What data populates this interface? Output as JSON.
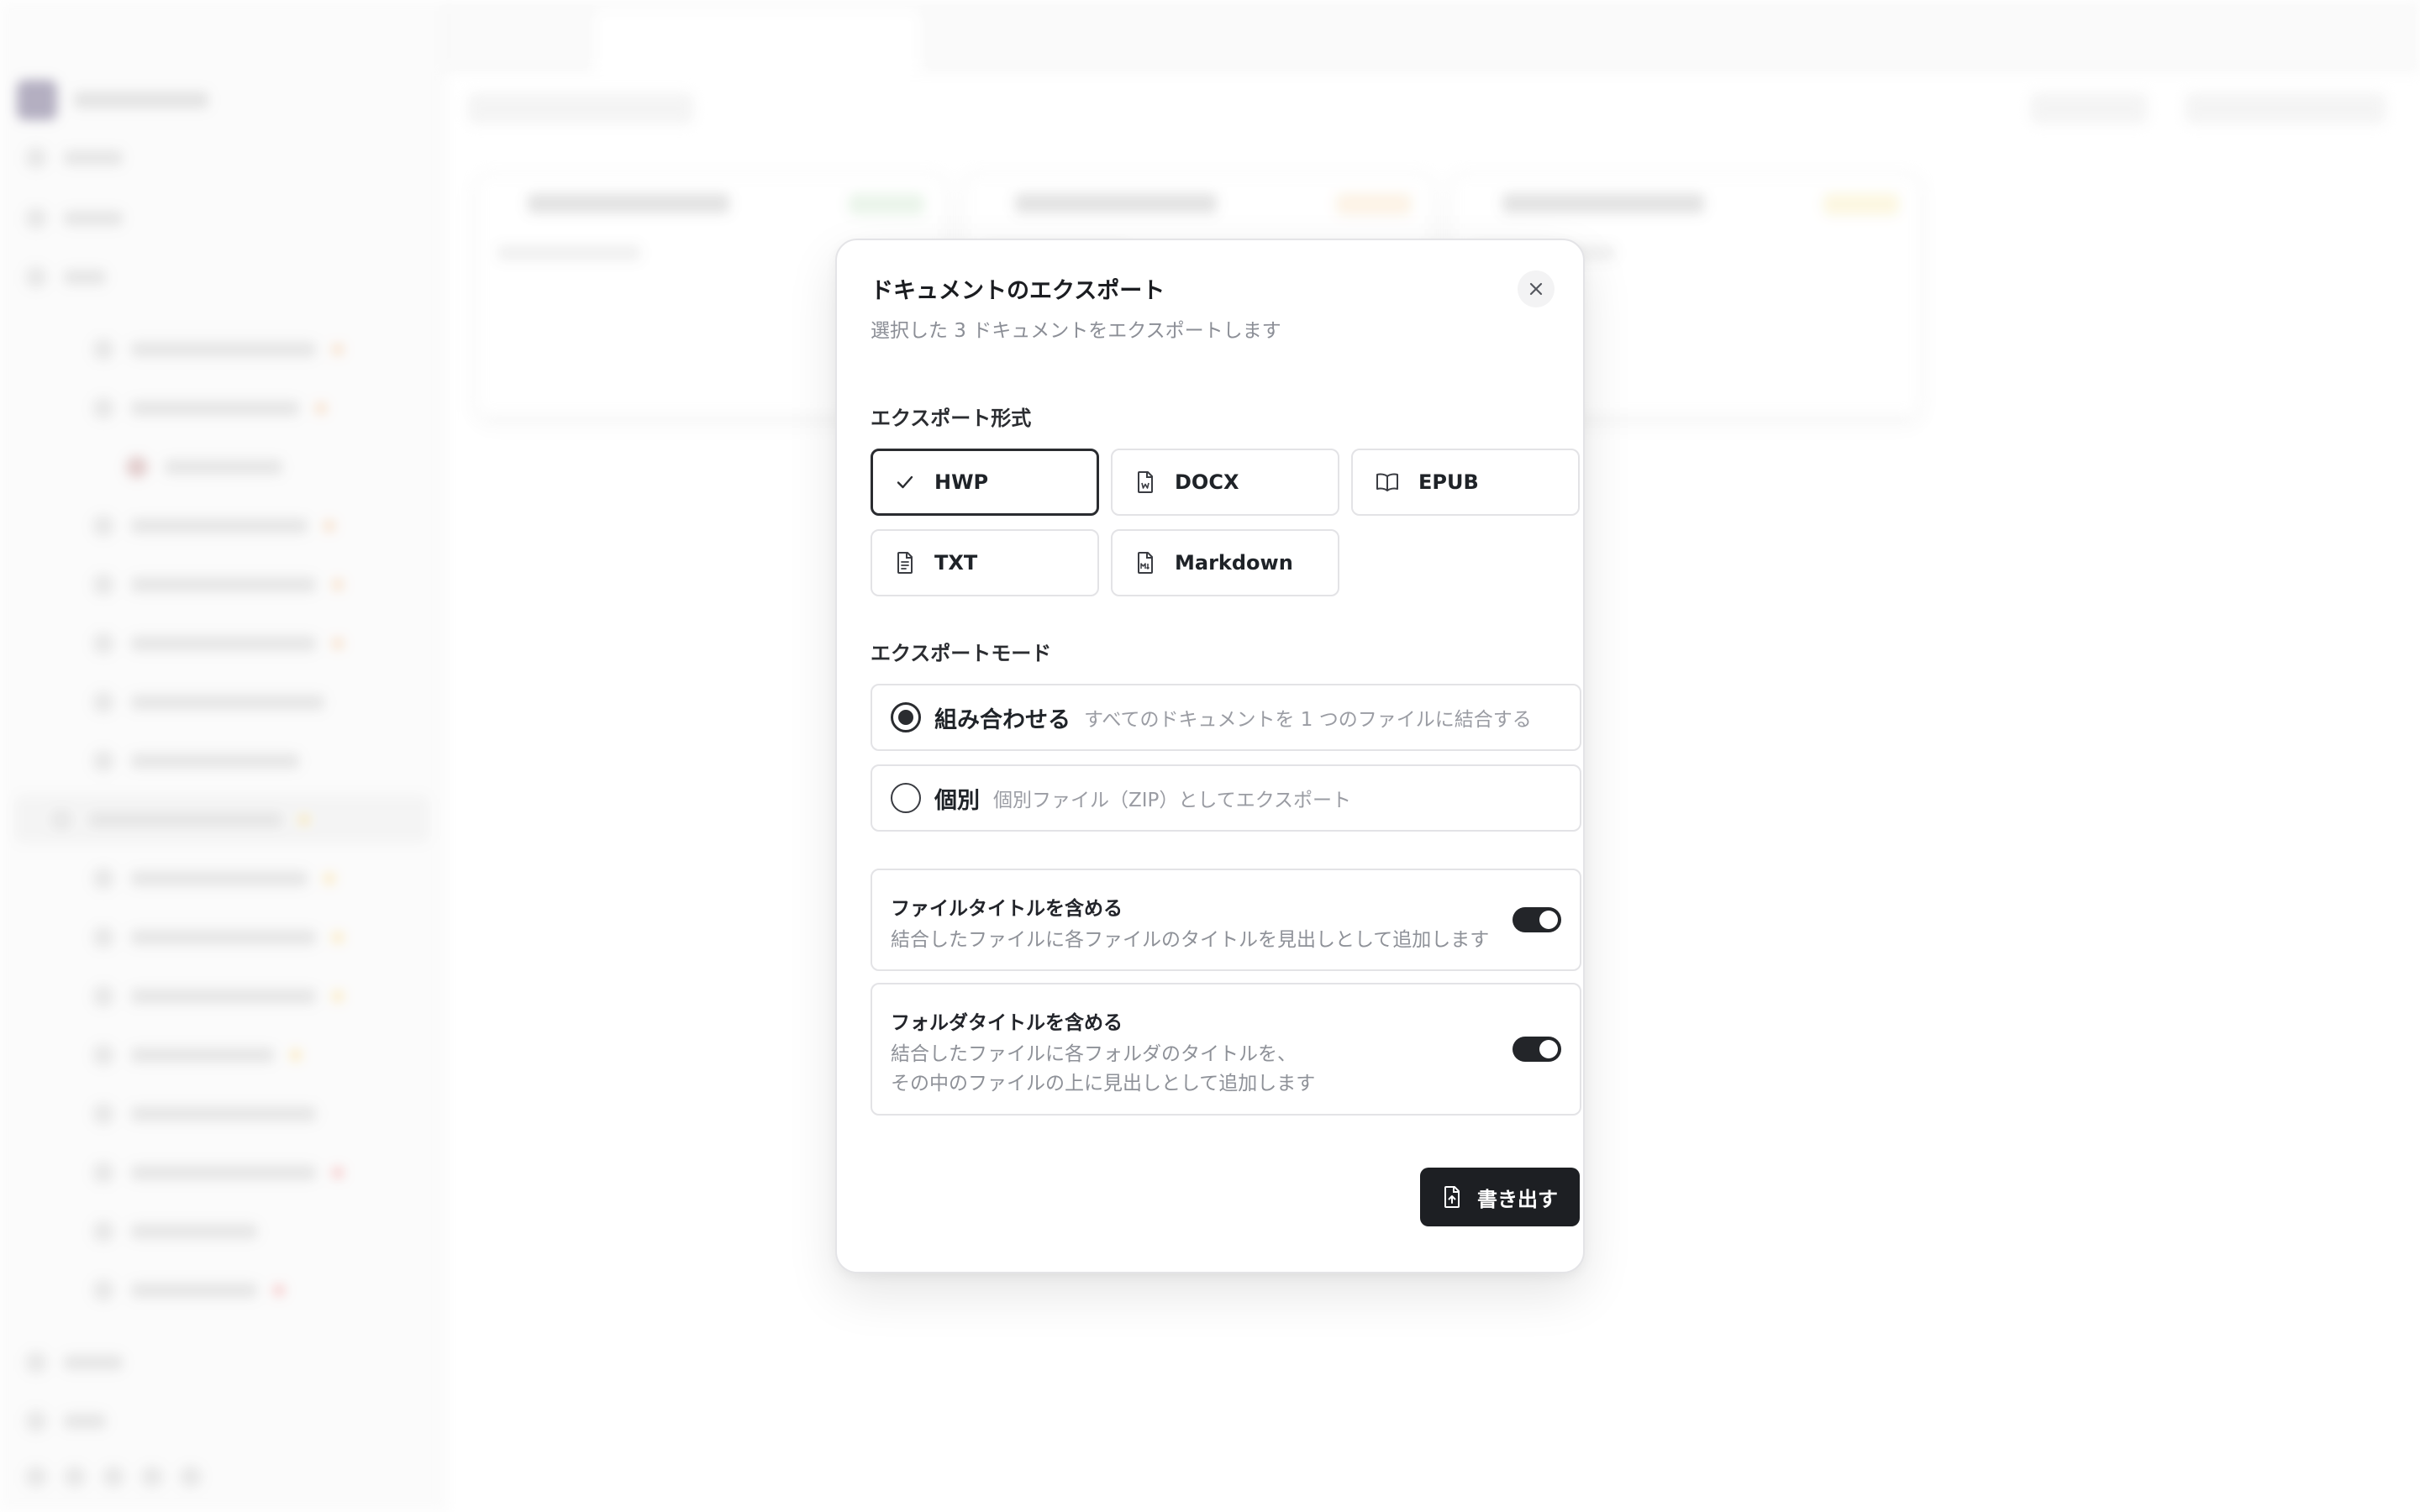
{
  "modal": {
    "title": "ドキュメントのエクスポート",
    "subtitle": "選択した 3 ドキュメントをエクスポートします",
    "close_icon": "close-icon"
  },
  "format": {
    "label": "エクスポート形式",
    "options": [
      {
        "label": "HWP",
        "icon": "check-icon",
        "selected": true
      },
      {
        "label": "DOCX",
        "icon": "docx-file-icon",
        "selected": false
      },
      {
        "label": "EPUB",
        "icon": "book-open-icon",
        "selected": false
      },
      {
        "label": "TXT",
        "icon": "text-file-icon",
        "selected": false
      },
      {
        "label": "Markdown",
        "icon": "markdown-file-icon",
        "selected": false
      }
    ]
  },
  "mode": {
    "label": "エクスポートモード",
    "options": [
      {
        "name": "組み合わせる",
        "desc": "すべてのドキュメントを 1 つのファイルに結合する",
        "selected": true
      },
      {
        "name": "個別",
        "desc": "個別ファイル（ZIP）としてエクスポート",
        "selected": false
      }
    ]
  },
  "toggles": [
    {
      "title": "ファイルタイトルを含める",
      "desc": "結合したファイルに各ファイルのタイトルを見出しとして追加します",
      "on": true
    },
    {
      "title": "フォルダタイトルを含める",
      "desc_line1": "結合したファイルに各フォルダのタイトルを、",
      "desc_line2": "その中のファイルの上に見出しとして追加します",
      "on": true
    }
  ],
  "actions": {
    "export_label": "書き出す",
    "export_icon": "file-export-icon"
  },
  "colors": {
    "primary": "#1d1f23",
    "border": "#e3e3e6",
    "muted_text": "#8e9198"
  }
}
